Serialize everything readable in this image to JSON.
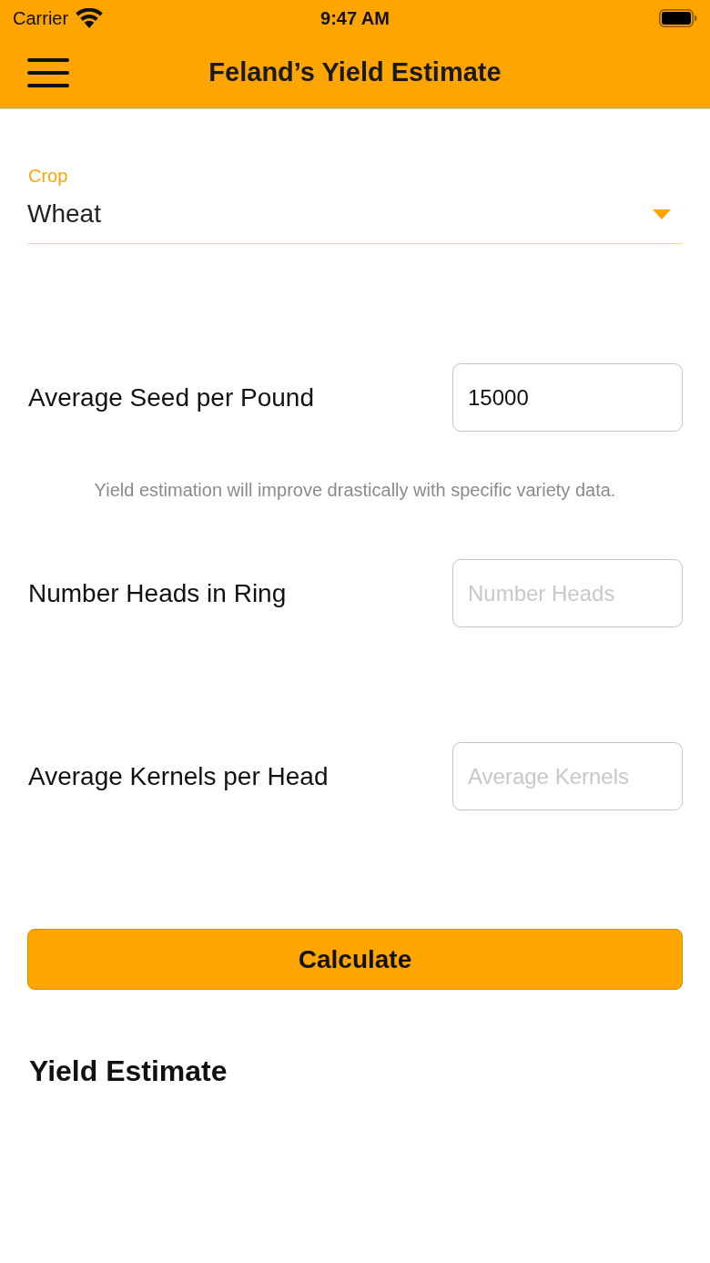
{
  "status_bar": {
    "carrier": "Carrier",
    "time": "9:47 AM"
  },
  "header": {
    "title": "Feland’s Yield Estimate"
  },
  "crop_select": {
    "label": "Crop",
    "value": "Wheat"
  },
  "fields": [
    {
      "label": "Average Seed per Pound",
      "value": "15000",
      "help_text": "Yield estimation will improve drastically with specific variety data."
    },
    {
      "label": "Number Heads in Ring",
      "placeholder": "Number Heads"
    },
    {
      "label": "Average Kernels per Head",
      "placeholder": "Average Kernels"
    }
  ],
  "calculate_button": {
    "label": "Calculate"
  },
  "result": {
    "title": "Yield Estimate"
  }
}
